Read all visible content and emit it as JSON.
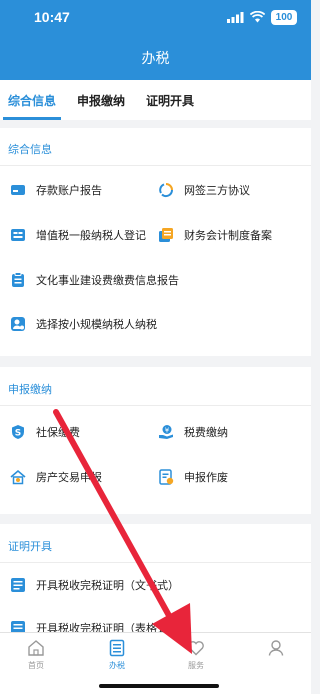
{
  "status_bar": {
    "time": "10:47",
    "battery": "100"
  },
  "header": {
    "title": "办税"
  },
  "tabs": [
    {
      "label": "综合信息"
    },
    {
      "label": "申报缴纳"
    },
    {
      "label": "证明开具"
    }
  ],
  "sections": {
    "zonghe": {
      "title": "综合信息",
      "items": [
        {
          "label": "存款账户报告",
          "icon": "card-icon"
        },
        {
          "label": "网签三方协议",
          "icon": "circular-arrows-icon"
        },
        {
          "label": "增值税一般纳税人登记",
          "icon": "tax-badge-icon"
        },
        {
          "label": "财务会计制度备案",
          "icon": "document-stack-icon"
        },
        {
          "label": "文化事业建设费缴费信息报告",
          "icon": "clipboard-icon"
        },
        {
          "label": "选择按小规模纳税人纳税",
          "icon": "person-badge-icon"
        }
      ]
    },
    "shenbao": {
      "title": "申报缴纳",
      "items": [
        {
          "label": "社保缴费",
          "icon": "social-security-icon"
        },
        {
          "label": "税费缴纳",
          "icon": "hand-coin-icon"
        },
        {
          "label": "房产交易申报",
          "icon": "house-icon"
        },
        {
          "label": "申报作废",
          "icon": "void-document-icon"
        }
      ]
    },
    "zhengming": {
      "title": "证明开具",
      "items": [
        {
          "label": "开具税收完税证明（文书式）",
          "icon": "tax-certificate-icon"
        },
        {
          "label": "开具税收完税证明（表格式）",
          "icon": "tax-certificate-icon"
        }
      ]
    }
  },
  "bottom_nav": [
    {
      "label": "首页",
      "icon": "home-icon"
    },
    {
      "label": "办税",
      "icon": "tax-list-icon"
    },
    {
      "label": "服务",
      "icon": "heart-icon"
    },
    {
      "label": "",
      "icon": "user-icon"
    }
  ],
  "colors": {
    "brand": "#2b8fd9",
    "annotation_arrow": "#e8253a"
  }
}
